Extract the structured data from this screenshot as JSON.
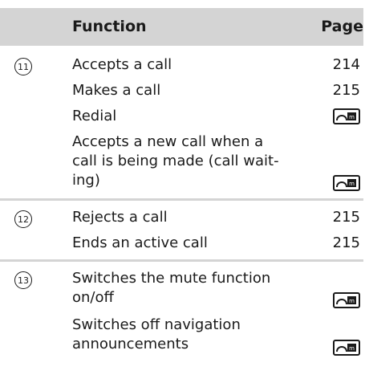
{
  "header": {
    "function": "Function",
    "page": "Page"
  },
  "sections": [
    {
      "number": "11",
      "rows": [
        {
          "text": "Accepts a call",
          "page": "214"
        },
        {
          "text": "Makes a call",
          "page": "215"
        },
        {
          "text": "Redial",
          "icon": "steering-wheel-book-icon"
        },
        {
          "text": "Accepts a new call when a\ncall is being made (call wait-\ning)",
          "icon": "steering-wheel-book-icon"
        }
      ]
    },
    {
      "number": "12",
      "rows": [
        {
          "text": "Rejects a call",
          "page": "215"
        },
        {
          "text": "Ends an active call",
          "page": "215"
        }
      ]
    },
    {
      "number": "13",
      "rows": [
        {
          "text": "Switches the mute function\non/off",
          "icon": "steering-wheel-book-icon"
        },
        {
          "text": "Switches off navigation\nannouncements",
          "icon": "steering-wheel-book-icon"
        }
      ]
    }
  ]
}
